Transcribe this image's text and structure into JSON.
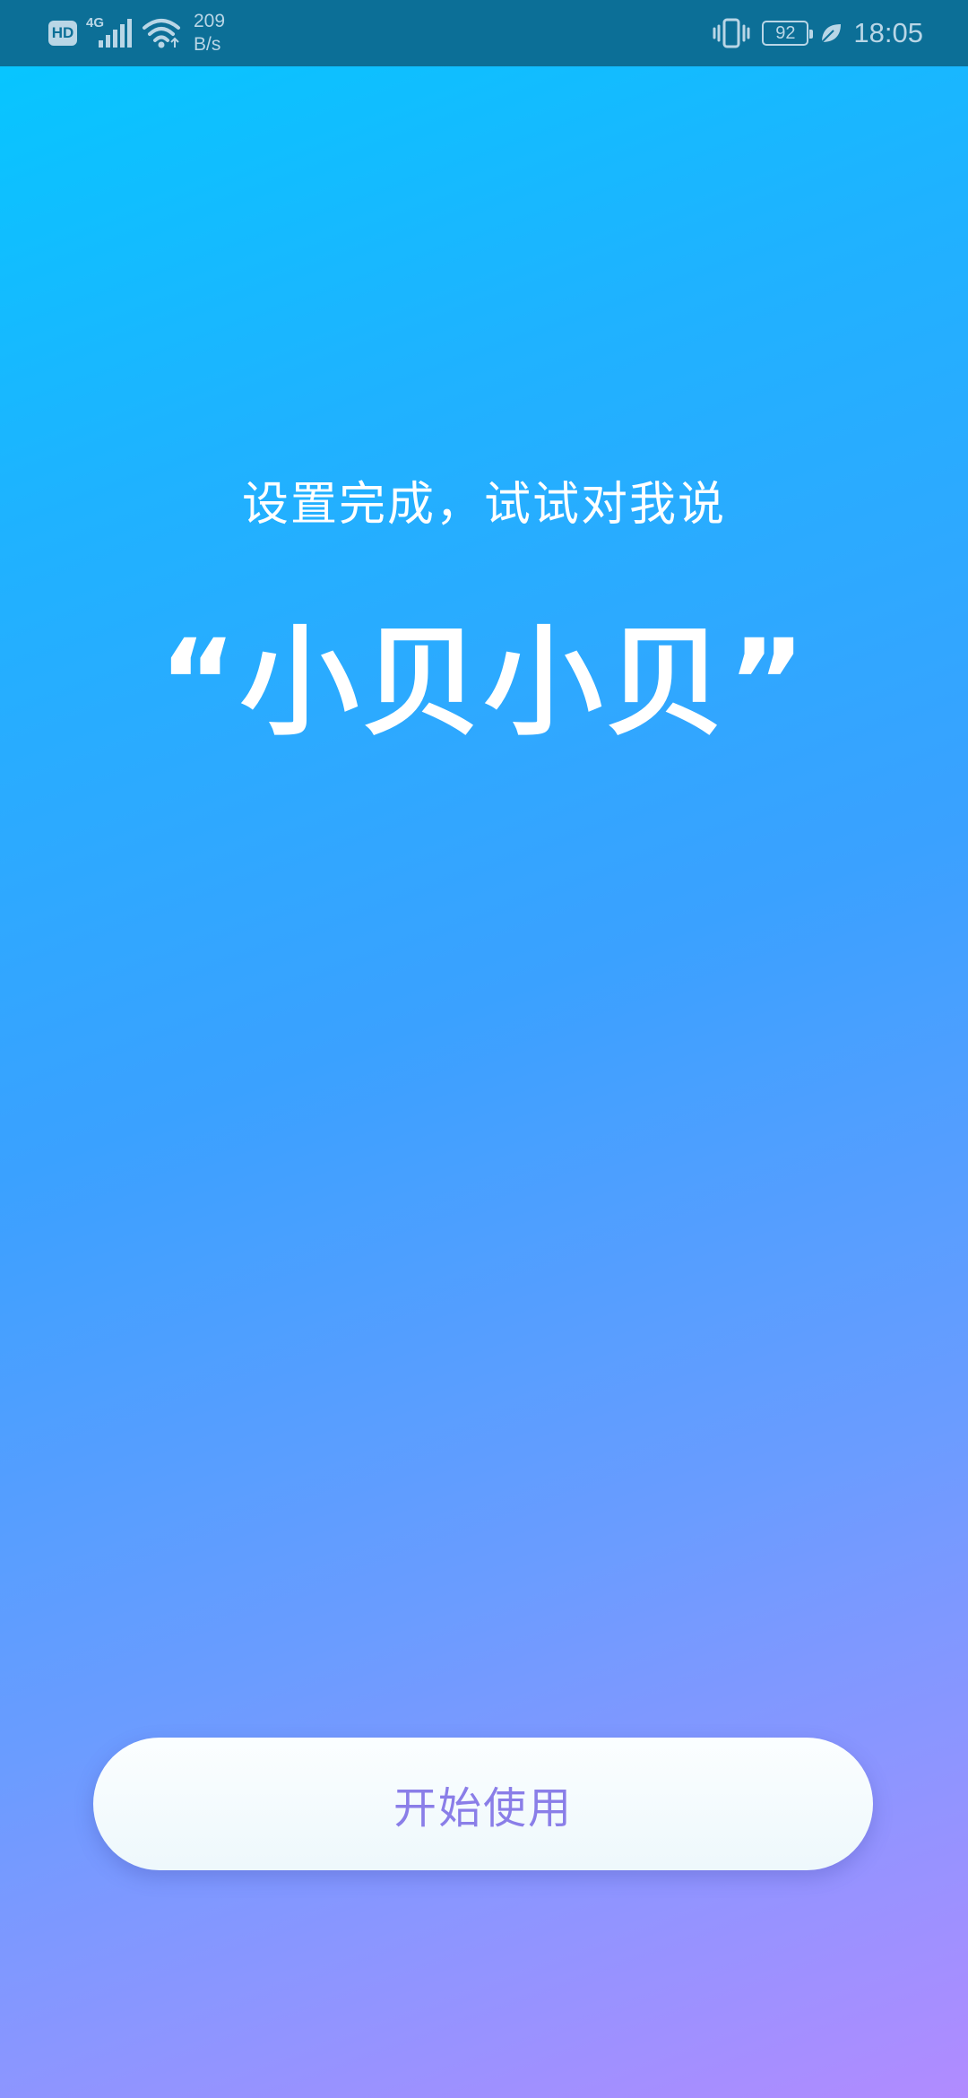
{
  "status_bar": {
    "hd_label": "HD",
    "network_label": "4G",
    "net_speed_value": "209",
    "net_speed_unit": "B/s",
    "battery_level": "92",
    "time": "18:05",
    "icons": [
      "hd-icon",
      "signal-icon",
      "wifi-icon",
      "vibrate-icon",
      "battery-icon",
      "leaf-icon"
    ]
  },
  "main": {
    "subtitle": "设置完成，试试对我说",
    "wake_word": "“小贝小贝”"
  },
  "start_button": {
    "label": "开始使用"
  },
  "colors": {
    "status_bar_bg": "#0c6f97",
    "gradient_top": "#04c8ff",
    "gradient_bottom": "#b18bff",
    "button_text": "#8a7ee8"
  }
}
